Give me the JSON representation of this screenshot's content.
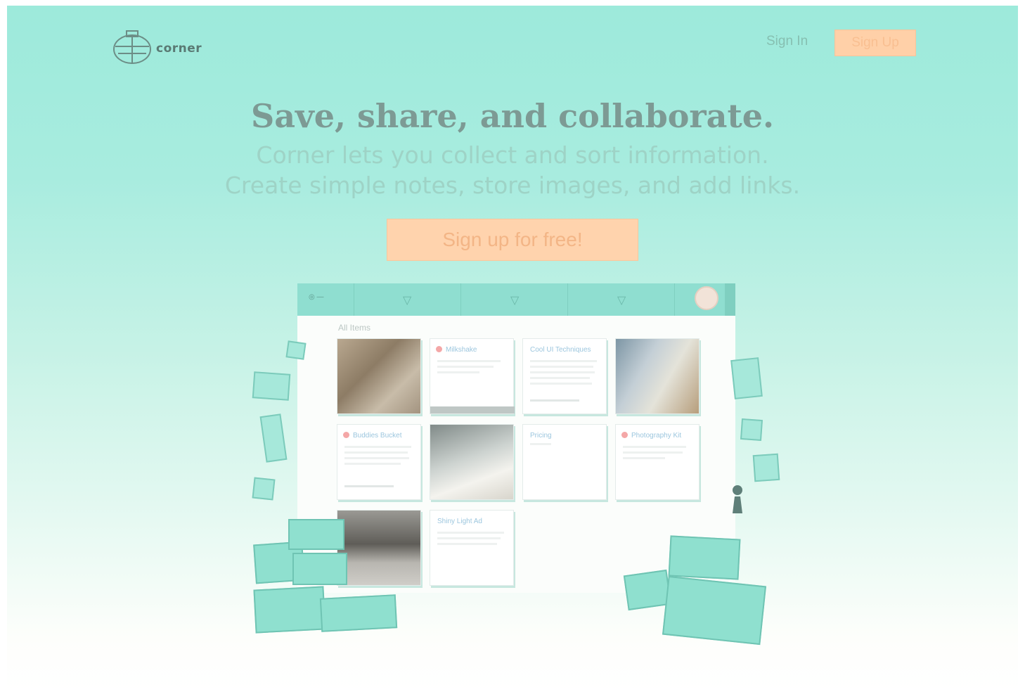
{
  "header": {
    "logo_text": "corner",
    "signin_label": "Sign In",
    "signup_label": "Sign Up"
  },
  "hero": {
    "title": "Save, share, and collaborate.",
    "subtitle_line1": "Corner lets you collect and sort information.",
    "subtitle_line2": "Create simple notes, store images, and add links.",
    "cta_label": "Sign up for free!"
  },
  "mock": {
    "section_label": "All Items",
    "cards": [
      {
        "type": "image",
        "title": ""
      },
      {
        "type": "note",
        "title": "Milkshake"
      },
      {
        "type": "note",
        "title": "Cool UI Techniques"
      },
      {
        "type": "image",
        "title": ""
      },
      {
        "type": "note",
        "title": "Buddies Bucket"
      },
      {
        "type": "image",
        "title": ""
      },
      {
        "type": "note",
        "title": "Pricing"
      },
      {
        "type": "note",
        "title": "Photography Kit"
      },
      {
        "type": "image",
        "title": ""
      },
      {
        "type": "note",
        "title": "Shiny Light Ad"
      }
    ]
  },
  "colors": {
    "background_top": "#9deadb",
    "accent_orange": "#ffd0a8",
    "title_text": "#7d9a94",
    "subtitle_text": "#9ed3c6"
  },
  "icons": [
    "corner-logo-icon",
    "filter-icon",
    "avatar",
    "pawn-icon",
    "box-illustration"
  ]
}
